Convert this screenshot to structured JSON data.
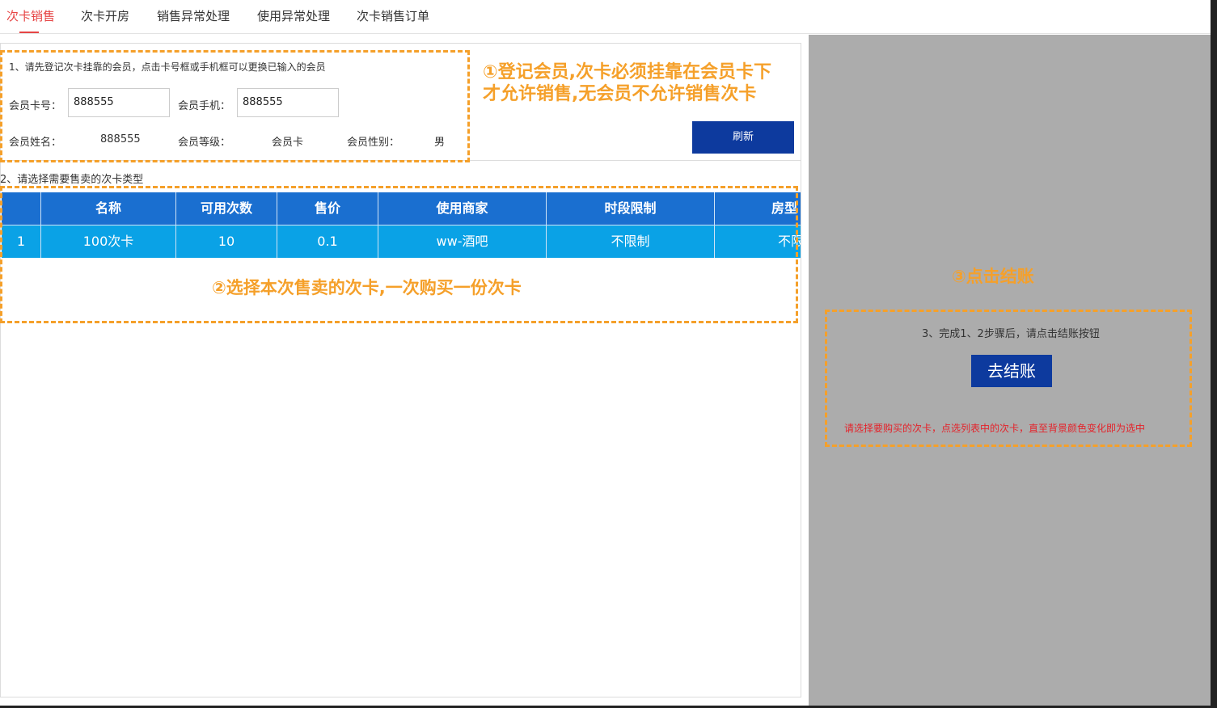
{
  "tabs": [
    {
      "label": "次卡销售",
      "active": true
    },
    {
      "label": "次卡开房"
    },
    {
      "label": "销售异常处理"
    },
    {
      "label": "使用异常处理"
    },
    {
      "label": "次卡销售订单"
    }
  ],
  "step1": {
    "hint": "1、请先登记次卡挂靠的会员，点击卡号框或手机框可以更换已输入的会员",
    "card_label": "会员卡号：",
    "card_value": "888555",
    "phone_label": "会员手机：",
    "phone_value": "888555",
    "name_label": "会员姓名：",
    "name_value": "888555",
    "level_label": "会员等级：",
    "level_value": "会员卡",
    "gender_label": "会员性别：",
    "gender_value": "男",
    "refresh_label": "刷新"
  },
  "step2": {
    "hint": "2、请选择需要售卖的次卡类型",
    "columns": [
      "",
      "名称",
      "可用次数",
      "售价",
      "使用商家",
      "时段限制",
      "房型"
    ],
    "rows": [
      [
        "1",
        "100次卡",
        "10",
        "0.1",
        "ww-酒吧",
        "不限制",
        "不限"
      ]
    ]
  },
  "step3": {
    "hint": "3、完成1、2步骤后，请点击结账按钮",
    "checkout_label": "去结账",
    "warning": "请选择要购买的次卡，点选列表中的次卡，直至背景颜色变化即为选中"
  },
  "annotations": {
    "a1_line1": "①登记会员,次卡必须挂靠在会员卡下",
    "a1_line2": "才允许销售,无会员不允许销售次卡",
    "a2": "②选择本次售卖的次卡,一次购买一份次卡",
    "a3": "③点击结账"
  },
  "colors": {
    "accent_tab": "#e64545",
    "table_header": "#1a6fd0",
    "table_row_selected": "#0aa2e6",
    "button": "#0d3a9e",
    "annotation": "#f5a02a",
    "warning": "#e4232b",
    "right_panel": "#acacac"
  }
}
